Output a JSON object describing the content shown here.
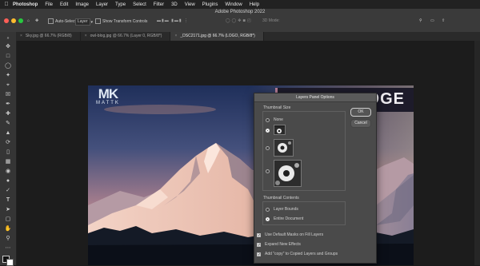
{
  "menubar": {
    "apple_icon": "apple-icon",
    "items": [
      "Photoshop",
      "File",
      "Edit",
      "Image",
      "Layer",
      "Type",
      "Select",
      "Filter",
      "3D",
      "View",
      "Plugins",
      "Window",
      "Help"
    ]
  },
  "window_title": "Adobe Photoshop 2022",
  "options": {
    "auto_select_label": "Auto-Select:",
    "auto_select_value": "Layer",
    "transform_label": "Show Transform Controls",
    "mode_label": "3D Mode:"
  },
  "tabs": [
    {
      "label": "Sky.jpg @ 66.7% (RGB/8)",
      "active": false
    },
    {
      "label": "owl-blog.jpg @ 66.7% (Layer 0, RGB/8*)",
      "active": false
    },
    {
      "label": "_DSC2171.jpg @ 66.7% (LOGO, RGB/8*)",
      "active": true
    }
  ],
  "canvas": {
    "logo_mark": "MK",
    "logo_text": "MATTK",
    "banner_text": "DGE"
  },
  "dialog": {
    "title": "Layers Panel Options",
    "thumbnail_size_label": "Thumbnail Size",
    "none_label": "None",
    "thumbnail_selected": "small",
    "thumbnail_contents_label": "Thumbnail Contents",
    "layer_bounds_label": "Layer Bounds",
    "entire_document_label": "Entire Document",
    "contents_selected": "entire_document",
    "use_default_masks_label": "Use Default Masks on Fill Layers",
    "expand_effects_label": "Expand New Effects",
    "add_copy_label": "Add \"copy\" to Copied Layers and Groups",
    "ok_label": "OK",
    "cancel_label": "Cancel"
  },
  "colors": {
    "menubar_bg": "#222222",
    "options_bg": "#3a3a3a",
    "dialog_bg": "#4a4a4a",
    "canvas_bg": "#1c1c1c"
  }
}
